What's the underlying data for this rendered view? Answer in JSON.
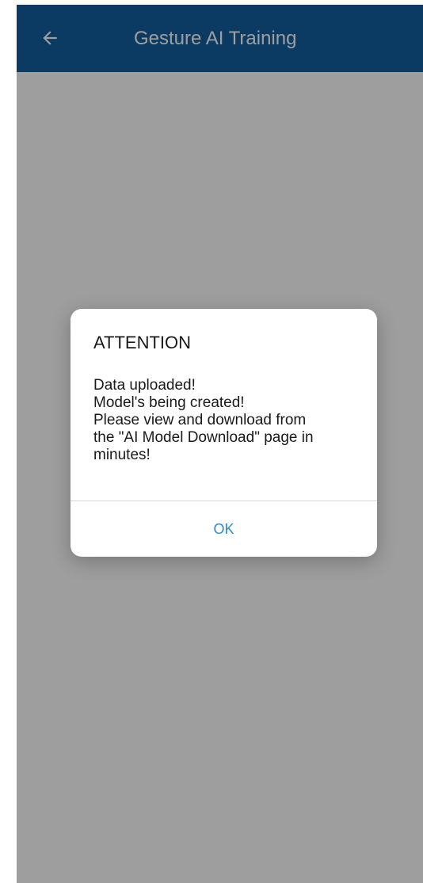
{
  "app_bar": {
    "title": "Gesture AI Training",
    "back_icon": "arrow-left-icon",
    "color": "#1260a0"
  },
  "dialog": {
    "title": "ATTENTION",
    "message_lines": [
      "Data uploaded!",
      "Model's being created!",
      "Please view and download from",
      "the \"AI Model Download\" page in",
      "minutes!"
    ],
    "ok_label": "OK",
    "ok_color": "#2a8ccf"
  }
}
